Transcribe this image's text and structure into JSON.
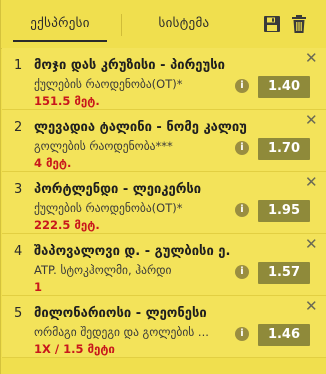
{
  "tabs": {
    "express": "ექსპრესი",
    "system": "სისტემა"
  },
  "icons": {
    "save": "save-icon",
    "trash": "trash-icon",
    "close": "close-icon",
    "info": "info-icon"
  },
  "colors": {
    "background": "#f0df4e",
    "odds_button": "#8f8a3a",
    "stake_text": "#c8171c",
    "info_icon": "#9a8e40"
  },
  "bets": [
    {
      "number": "1",
      "title": "მოჯი დას კრუზისი - პირეუსი",
      "market": "ქულების რაოდენობა(OT)*",
      "stake": "151.5 მეტ.",
      "odds": "1.40"
    },
    {
      "number": "2",
      "title": "ლევადია ტალინი - ნომე კალიუ",
      "market": "გოლების რაოდენობა***",
      "stake": "4 მეტ.",
      "odds": "1.70"
    },
    {
      "number": "3",
      "title": "პორტლენდი - ლეიკერსი",
      "market": "ქულების რაოდენობა(OT)*",
      "stake": "222.5 მეტ.",
      "odds": "1.95"
    },
    {
      "number": "4",
      "title": "შაპოვალოვი დ. - გულბისი ე.",
      "market": "ATP. სტოკჰოლმი, ჰარდი",
      "stake": "1",
      "odds": "1.57"
    },
    {
      "number": "5",
      "title": "მილონარიოსი - ლეონესი",
      "market": "ორმაგი შედეგი და გოლების ...",
      "stake": "1X / 1.5 მეტი",
      "odds": "1.46"
    }
  ]
}
